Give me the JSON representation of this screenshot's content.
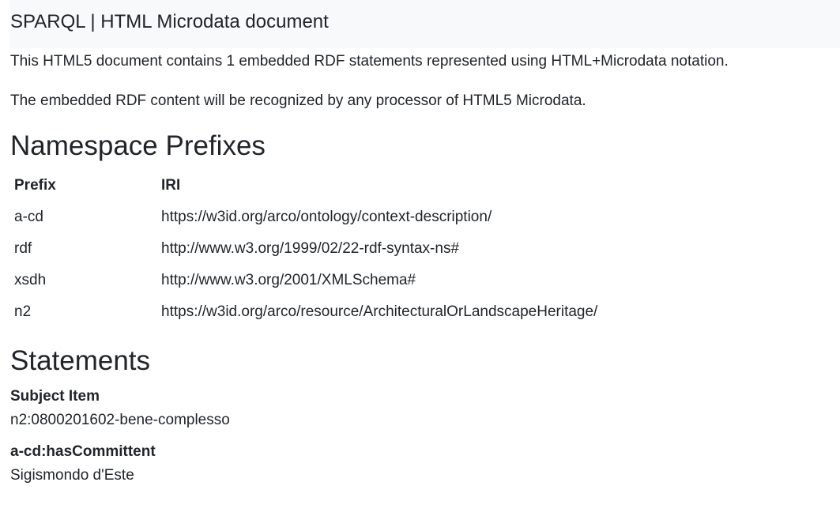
{
  "header": {
    "title": "SPARQL | HTML Microdata document"
  },
  "intro": {
    "line1": "This HTML5 document contains 1 embedded RDF statements represented using HTML+Microdata notation.",
    "line2": "The embedded RDF content will be recognized by any processor of HTML5 Microdata."
  },
  "namespaces": {
    "heading": "Namespace Prefixes",
    "columns": [
      "Prefix",
      "IRI"
    ],
    "rows": [
      {
        "prefix": "a-cd",
        "iri": "https://w3id.org/arco/ontology/context-description/"
      },
      {
        "prefix": "rdf",
        "iri": "http://www.w3.org/1999/02/22-rdf-syntax-ns#"
      },
      {
        "prefix": "xsdh",
        "iri": "http://www.w3.org/2001/XMLSchema#"
      },
      {
        "prefix": "n2",
        "iri": "https://w3id.org/arco/resource/ArchitecturalOrLandscapeHeritage/"
      }
    ]
  },
  "statements": {
    "heading": "Statements",
    "subject_label": "Subject Item",
    "subject_value": "n2:0800201602-bene-complesso",
    "predicate_label": "a-cd:hasCommittent",
    "object_value": "Sigismondo d'Este"
  }
}
